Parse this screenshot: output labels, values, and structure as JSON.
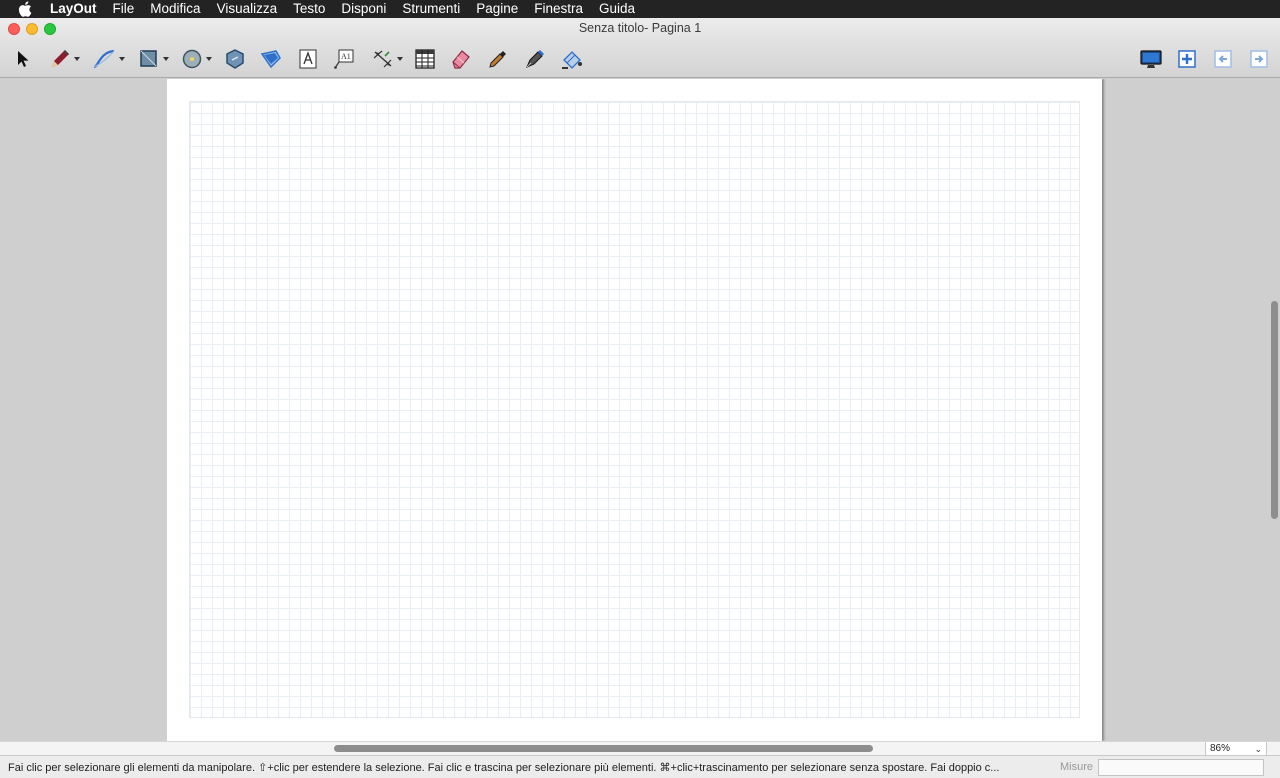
{
  "menubar": {
    "app_name": "LayOut",
    "items": [
      "File",
      "Modifica",
      "Visualizza",
      "Testo",
      "Disponi",
      "Strumenti",
      "Pagine",
      "Finestra",
      "Guida"
    ]
  },
  "window": {
    "title": "Senza titolo- Pagina 1"
  },
  "toolbar": {
    "tools": [
      {
        "name": "select-tool",
        "icon": "arrow-pointer-icon"
      },
      {
        "name": "line-tool",
        "icon": "pencil-icon",
        "dropdown": true
      },
      {
        "name": "arc-tool",
        "icon": "arc-curve-icon",
        "dropdown": true
      },
      {
        "name": "rectangle-tool",
        "icon": "rectangle-icon",
        "dropdown": true
      },
      {
        "name": "circle-tool",
        "icon": "circle-icon",
        "dropdown": true
      },
      {
        "name": "polygon-tool",
        "icon": "polygon-icon"
      },
      {
        "name": "offset-tool",
        "icon": "offset-icon"
      },
      {
        "name": "text-tool",
        "icon": "text-box-icon"
      },
      {
        "name": "label-tool",
        "icon": "label-icon"
      },
      {
        "name": "dimension-tool",
        "icon": "dimension-icon",
        "dropdown": true
      },
      {
        "name": "table-tool",
        "icon": "table-icon"
      },
      {
        "name": "eraser-tool",
        "icon": "eraser-icon"
      },
      {
        "name": "style-tool",
        "icon": "eyedropper-icon"
      },
      {
        "name": "split-tool",
        "icon": "pen-nib-icon"
      },
      {
        "name": "join-tool",
        "icon": "paint-bucket-icon"
      }
    ],
    "right_tools": [
      {
        "name": "presentation-button",
        "icon": "monitor-icon"
      },
      {
        "name": "add-page-button",
        "icon": "add-page-icon"
      },
      {
        "name": "previous-page-button",
        "icon": "page-previous-icon"
      },
      {
        "name": "next-page-button",
        "icon": "page-next-icon"
      }
    ]
  },
  "statusbar": {
    "hint": "Fai clic per selezionare gli elementi da manipolare. ⇧+clic per estendere la selezione. Fai clic e trascina per selezionare più elementi. ⌘+clic+trascinamento per selezionare senza spostare. Fai doppio c...",
    "measure_label": "Misure",
    "measure_value": ""
  },
  "zoom": {
    "value": "86%"
  },
  "colors": {
    "menubar_bg": "#232323",
    "accent_blue": "#2e6fcb",
    "grid_line": "#e9eef2"
  }
}
